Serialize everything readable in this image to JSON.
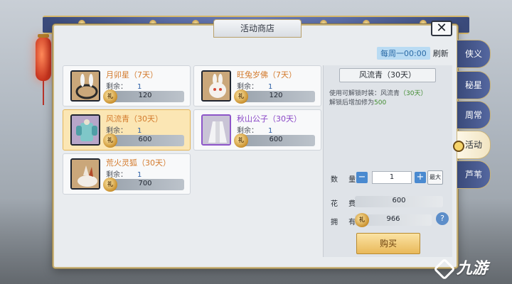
{
  "window": {
    "title": "活动商店",
    "close_glyph": "✕"
  },
  "refresh": {
    "day": "每周一00:00",
    "label": "刷新"
  },
  "items": [
    {
      "name": "月卯星（7天）",
      "remain_label": "剩余：",
      "remain": "1",
      "price": "120",
      "rarity": "orange"
    },
    {
      "name": "旺兔岁佛（7天）",
      "remain_label": "剩余：",
      "remain": "1",
      "price": "120",
      "rarity": "orange"
    },
    {
      "name": "风流青（30天）",
      "remain_label": "剩余：",
      "remain": "1",
      "price": "600",
      "rarity": "orange",
      "selected": true
    },
    {
      "name": "秋山公子（30天）",
      "remain_label": "剩余：",
      "remain": "1",
      "price": "600",
      "rarity": "purple"
    },
    {
      "name": "荒火灵狐（30天）",
      "remain_label": "剩余：",
      "remain": "1",
      "price": "700",
      "rarity": "orange"
    }
  ],
  "detail": {
    "name": "风流青（30天）",
    "desc_line1_prefix": "使用可解锁时装：风流青",
    "desc_line1_suffix": "（30天）",
    "desc_line2_prefix": "解锁后增加修为",
    "desc_line2_value": "500",
    "qty_label": "数 量",
    "qty_value": "1",
    "max_label": "最大",
    "cost_label": "花 费",
    "cost_value": "600",
    "own_label": "拥 有",
    "own_value": "966",
    "help_glyph": "?",
    "buy_label": "购买",
    "minus_glyph": "−",
    "plus_glyph": "+"
  },
  "coin_glyph": "礼",
  "side_tabs": [
    {
      "label": "侠义"
    },
    {
      "label": "秘星"
    },
    {
      "label": "周常"
    },
    {
      "label": "活动",
      "active": true
    },
    {
      "label": "芦苇"
    }
  ],
  "watermark": "九游",
  "colors": {
    "accent_orange": "#d37a2c",
    "accent_purple": "#8a47c7",
    "selected_bg": "#fbe6b4",
    "tab_blue": "#3a4a7a"
  }
}
